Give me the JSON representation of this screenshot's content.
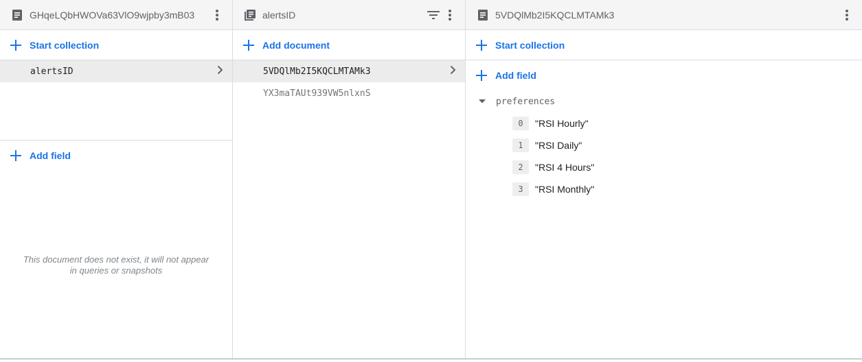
{
  "panel1": {
    "title": "GHqeLQbHWOVa63VlO9wjpby3mB03",
    "start_collection": "Start collection",
    "items": [
      {
        "label": "alertsID"
      }
    ],
    "add_field": "Add field",
    "empty_note": "This document does not exist, it will not appear in queries or snapshots"
  },
  "panel2": {
    "title": "alertsID",
    "add_document": "Add document",
    "items": [
      {
        "label": "5VDQlMb2I5KQCLMTAMk3"
      },
      {
        "label": "YX3maTAUt939VW5nlxnS"
      }
    ]
  },
  "panel3": {
    "title": "5VDQlMb2I5KQCLMTAMk3",
    "start_collection": "Start collection",
    "add_field": "Add field",
    "field": {
      "name": "preferences",
      "items": [
        {
          "index": "0",
          "value": "\"RSI Hourly\""
        },
        {
          "index": "1",
          "value": "\"RSI Daily\""
        },
        {
          "index": "2",
          "value": "\"RSI 4 Hours\""
        },
        {
          "index": "3",
          "value": "\"RSI Monthly\""
        }
      ]
    }
  },
  "icons": {
    "document": "document-icon",
    "collection": "collection-icon",
    "more": "more-vert-icon",
    "filter": "filter-icon",
    "plus": "plus-icon",
    "chevron": "chevron-right-icon",
    "caret": "caret-down-icon"
  },
  "colors": {
    "accent": "#1a73e8",
    "header_bg": "#f5f5f5",
    "selected_bg": "#ececec"
  }
}
